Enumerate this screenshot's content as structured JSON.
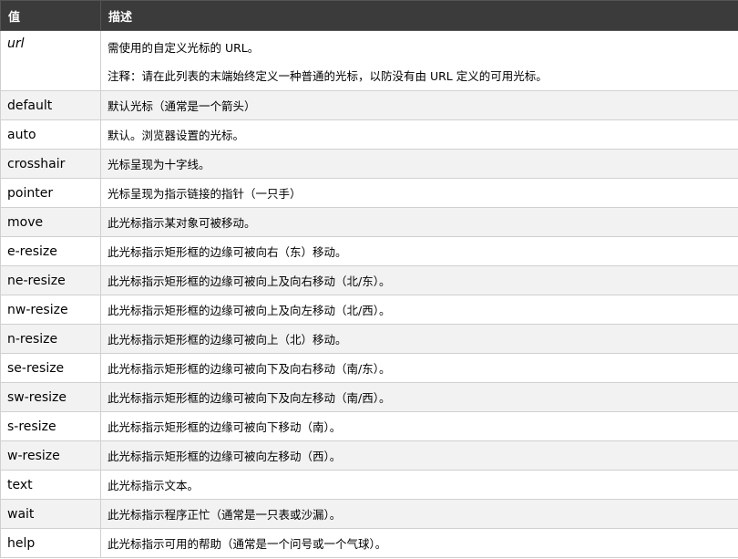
{
  "header": {
    "value": "值",
    "description": "描述"
  },
  "url_row": {
    "value": "url",
    "desc1": "需使用的自定义光标的 URL。",
    "desc2": "注释：请在此列表的末端始终定义一种普通的光标，以防没有由 URL 定义的可用光标。"
  },
  "rows": [
    {
      "value": "default",
      "desc": "默认光标（通常是一个箭头）"
    },
    {
      "value": "auto",
      "desc": "默认。浏览器设置的光标。"
    },
    {
      "value": "crosshair",
      "desc": "光标呈现为十字线。"
    },
    {
      "value": "pointer",
      "desc": "光标呈现为指示链接的指针（一只手）"
    },
    {
      "value": "move",
      "desc": "此光标指示某对象可被移动。"
    },
    {
      "value": "e-resize",
      "desc": "此光标指示矩形框的边缘可被向右（东）移动。"
    },
    {
      "value": "ne-resize",
      "desc": "此光标指示矩形框的边缘可被向上及向右移动（北/东）。"
    },
    {
      "value": "nw-resize",
      "desc": "此光标指示矩形框的边缘可被向上及向左移动（北/西）。"
    },
    {
      "value": "n-resize",
      "desc": "此光标指示矩形框的边缘可被向上（北）移动。"
    },
    {
      "value": "se-resize",
      "desc": "此光标指示矩形框的边缘可被向下及向右移动（南/东）。"
    },
    {
      "value": "sw-resize",
      "desc": "此光标指示矩形框的边缘可被向下及向左移动（南/西）。"
    },
    {
      "value": "s-resize",
      "desc": "此光标指示矩形框的边缘可被向下移动（南）。"
    },
    {
      "value": "w-resize",
      "desc": "此光标指示矩形框的边缘可被向左移动（西）。"
    },
    {
      "value": "text",
      "desc": "此光标指示文本。"
    },
    {
      "value": "wait",
      "desc": "此光标指示程序正忙（通常是一只表或沙漏）。"
    },
    {
      "value": "help",
      "desc": "此光标指示可用的帮助（通常是一个问号或一个气球）。"
    }
  ]
}
